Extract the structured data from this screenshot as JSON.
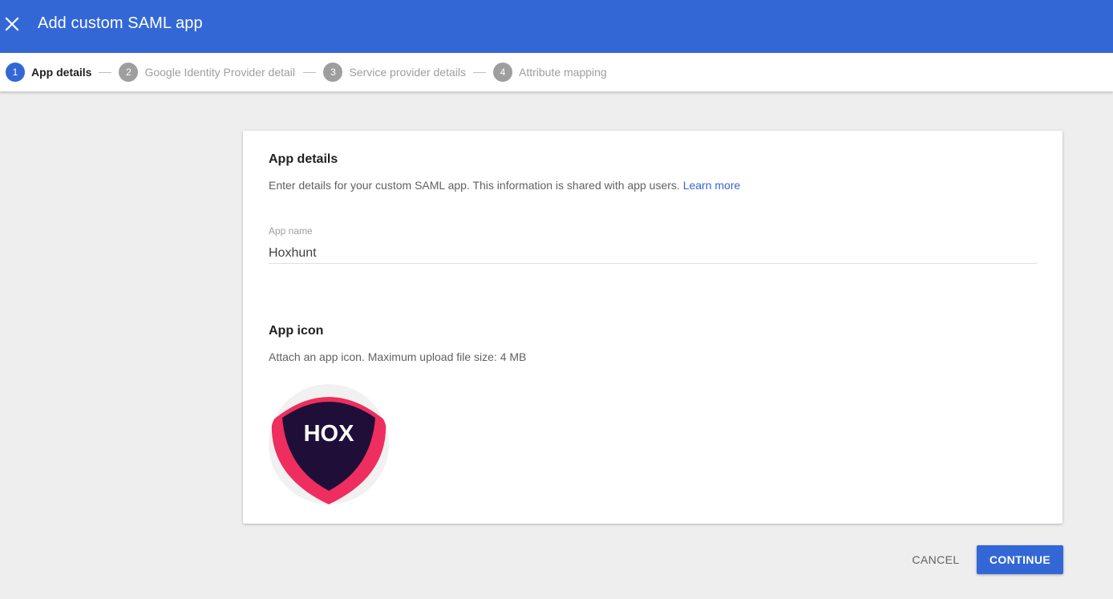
{
  "header": {
    "title": "Add custom SAML app",
    "close_icon": "close-icon",
    "color": "#3367d6"
  },
  "stepper": {
    "steps": [
      {
        "number": "1",
        "label": "App details",
        "active": true
      },
      {
        "number": "2",
        "label": "Google Identity Provider details",
        "active": false
      },
      {
        "number": "3",
        "label": "Service provider details",
        "active": false
      },
      {
        "number": "4",
        "label": "Attribute mapping",
        "active": false
      }
    ]
  },
  "card": {
    "app_details": {
      "title": "App details",
      "description": "Enter details for your custom SAML app. This information is shared with app users.",
      "learn_more": "Learn more"
    },
    "app_name": {
      "label": "App name",
      "value": "Hoxhunt"
    },
    "app_icon": {
      "title": "App icon",
      "description": "Attach an app icon. Maximum upload file size: 4 MB",
      "logo_text": "HOX",
      "logo_colors": {
        "outer": "#ee2e5e",
        "inner": "#1f0f38",
        "text": "#ffffff"
      }
    }
  },
  "footer": {
    "cancel_label": "CANCEL",
    "continue_label": "CONTINUE"
  }
}
